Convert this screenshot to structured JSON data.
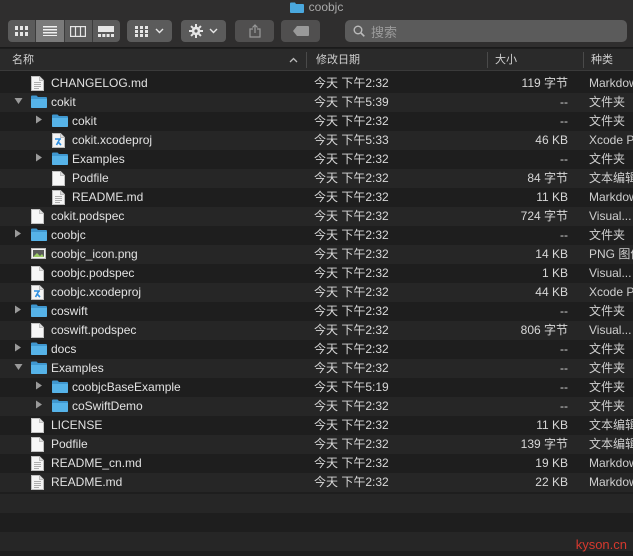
{
  "window": {
    "title": "coobjc"
  },
  "toolbar": {
    "view_icons": [
      "icon-view-icon",
      "list-view-icon",
      "column-view-icon",
      "gallery-view-icon"
    ],
    "search_placeholder": "搜索"
  },
  "header": {
    "name": "名称",
    "date": "修改日期",
    "size": "大小",
    "kind": "种类"
  },
  "rows": [
    {
      "name": "CHANGELOG.md",
      "date": "今天 下午2:32",
      "size": "119 字节",
      "kind": "Markdown",
      "type": "doc",
      "indent": 0,
      "disclosure": ""
    },
    {
      "name": "cokit",
      "date": "今天 下午5:39",
      "size": "--",
      "kind": "文件夹",
      "type": "folder",
      "indent": 0,
      "disclosure": "open"
    },
    {
      "name": "cokit",
      "date": "今天 下午2:32",
      "size": "--",
      "kind": "文件夹",
      "type": "folder",
      "indent": 1,
      "disclosure": "closed"
    },
    {
      "name": "cokit.xcodeproj",
      "date": "今天 下午5:33",
      "size": "46 KB",
      "kind": "Xcode Project",
      "type": "xcode",
      "indent": 1,
      "disclosure": ""
    },
    {
      "name": "Examples",
      "date": "今天 下午2:32",
      "size": "--",
      "kind": "文件夹",
      "type": "folder",
      "indent": 1,
      "disclosure": "closed"
    },
    {
      "name": "Podfile",
      "date": "今天 下午2:32",
      "size": "84 字节",
      "kind": "文本编辑",
      "type": "blank",
      "indent": 1,
      "disclosure": ""
    },
    {
      "name": "README.md",
      "date": "今天 下午2:32",
      "size": "11 KB",
      "kind": "Markdown",
      "type": "doc",
      "indent": 1,
      "disclosure": ""
    },
    {
      "name": "cokit.podspec",
      "date": "今天 下午2:32",
      "size": "724 字节",
      "kind": "Visual...",
      "type": "blank",
      "indent": 0,
      "disclosure": ""
    },
    {
      "name": "coobjc",
      "date": "今天 下午2:32",
      "size": "--",
      "kind": "文件夹",
      "type": "folder",
      "indent": 0,
      "disclosure": "closed"
    },
    {
      "name": "coobjc_icon.png",
      "date": "今天 下午2:32",
      "size": "14 KB",
      "kind": "PNG 图像",
      "type": "image",
      "indent": 0,
      "disclosure": ""
    },
    {
      "name": "coobjc.podspec",
      "date": "今天 下午2:32",
      "size": "1 KB",
      "kind": "Visual...",
      "type": "blank",
      "indent": 0,
      "disclosure": ""
    },
    {
      "name": "coobjc.xcodeproj",
      "date": "今天 下午2:32",
      "size": "44 KB",
      "kind": "Xcode Project",
      "type": "xcode",
      "indent": 0,
      "disclosure": ""
    },
    {
      "name": "coswift",
      "date": "今天 下午2:32",
      "size": "--",
      "kind": "文件夹",
      "type": "folder",
      "indent": 0,
      "disclosure": "closed"
    },
    {
      "name": "coswift.podspec",
      "date": "今天 下午2:32",
      "size": "806 字节",
      "kind": "Visual...",
      "type": "blank",
      "indent": 0,
      "disclosure": ""
    },
    {
      "name": "docs",
      "date": "今天 下午2:32",
      "size": "--",
      "kind": "文件夹",
      "type": "folder",
      "indent": 0,
      "disclosure": "closed"
    },
    {
      "name": "Examples",
      "date": "今天 下午2:32",
      "size": "--",
      "kind": "文件夹",
      "type": "folder",
      "indent": 0,
      "disclosure": "open"
    },
    {
      "name": "coobjcBaseExample",
      "date": "今天 下午5:19",
      "size": "--",
      "kind": "文件夹",
      "type": "folder",
      "indent": 1,
      "disclosure": "closed"
    },
    {
      "name": "coSwiftDemo",
      "date": "今天 下午2:32",
      "size": "--",
      "kind": "文件夹",
      "type": "folder",
      "indent": 1,
      "disclosure": "closed"
    },
    {
      "name": "LICENSE",
      "date": "今天 下午2:32",
      "size": "11 KB",
      "kind": "文本编辑",
      "type": "blank",
      "indent": 0,
      "disclosure": ""
    },
    {
      "name": "Podfile",
      "date": "今天 下午2:32",
      "size": "139 字节",
      "kind": "文本编辑",
      "type": "blank",
      "indent": 0,
      "disclosure": ""
    },
    {
      "name": "README_cn.md",
      "date": "今天 下午2:32",
      "size": "19 KB",
      "kind": "Markdown",
      "type": "doc",
      "indent": 0,
      "disclosure": ""
    },
    {
      "name": "README.md",
      "date": "今天 下午2:32",
      "size": "22 KB",
      "kind": "Markdown",
      "type": "doc",
      "indent": 0,
      "disclosure": ""
    }
  ],
  "watermark": "kyson.cn",
  "colors": {
    "folder": "#4aa8de",
    "background": "#1e1e1e",
    "stripe": "#262626",
    "watermark": "#d6392e"
  }
}
